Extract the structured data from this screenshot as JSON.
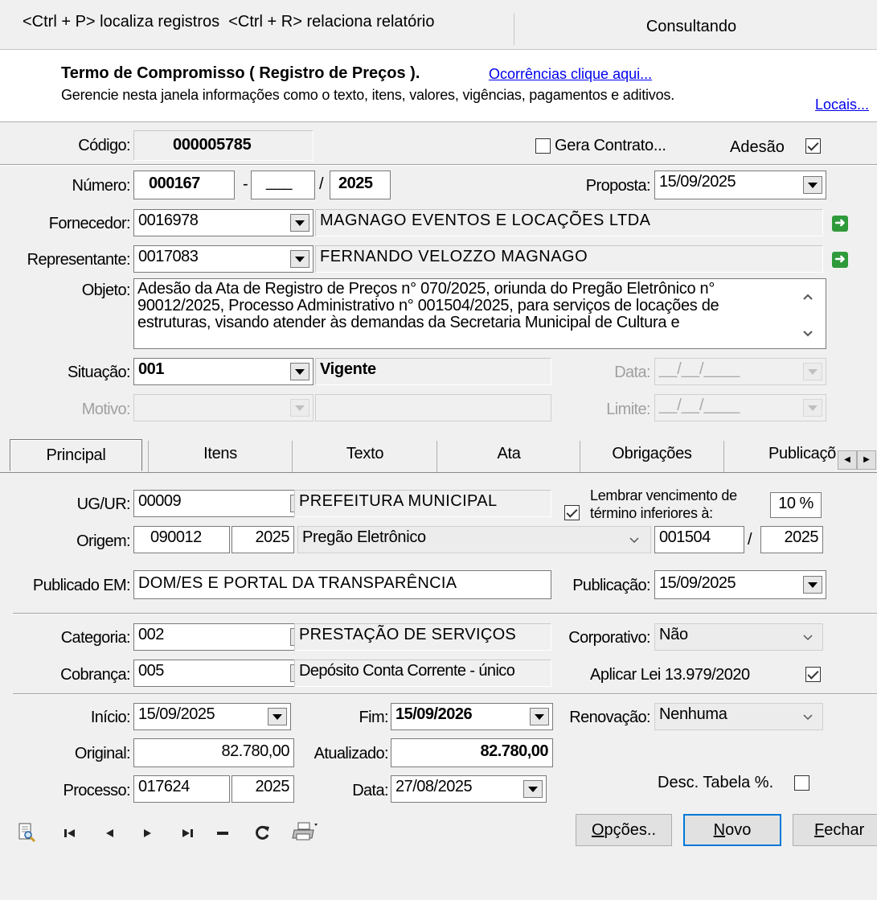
{
  "status_bar": {
    "shortcuts": "<Ctrl + P> localiza registros  <Ctrl + R> relaciona relatório",
    "mode": "Consultando"
  },
  "header": {
    "title": "Termo de Compromisso ( Registro de Preços ).",
    "occurrences_link": "Ocorrências clique aqui...",
    "description": "Gerencie nesta janela informações como o texto, itens, valores, vigências, pagamentos e aditivos.",
    "locais_link": "Locais..."
  },
  "form": {
    "codigo_label": "Código:",
    "codigo": "000005785",
    "gera_contrato_label": "Gera Contrato...",
    "gera_contrato": false,
    "adesao_label": "Adesão",
    "adesao": true,
    "numero_label": "Número:",
    "numero": "000167",
    "numero_sep": "-",
    "numero_suffix": "___",
    "numero_slash": "/",
    "numero_year": "2025",
    "proposta_label": "Proposta:",
    "proposta": "15/09/2025",
    "fornecedor_label": "Fornecedor:",
    "fornecedor_code": "0016978",
    "fornecedor_name": "MAGNAGO EVENTOS E LOCAÇÕES LTDA",
    "representante_label": "Representante:",
    "representante_code": "0017083",
    "representante_name": "FERNANDO VELOZZO MAGNAGO",
    "objeto_label": "Objeto:",
    "objeto_line1": "Adesão da Ata de Registro de Preços n° 070/2025, oriunda do Pregão Eletrônico n°",
    "objeto_line2": "90012/2025, Processo Administrativo n° 001504/2025, para serviços de locações de",
    "objeto_line3": "estruturas, visando atender às demandas da Secretaria Municipal de Cultura e",
    "situacao_label": "Situação:",
    "situacao_code": "001",
    "situacao_name": "Vigente",
    "data_label": "Data:",
    "data": "__/__/____",
    "motivo_label": "Motivo:",
    "motivo": "",
    "limite_label": "Limite:",
    "limite": "__/__/____"
  },
  "tabs": [
    "Principal",
    "Itens",
    "Texto",
    "Ata",
    "Obrigações",
    "Publicaçõ"
  ],
  "principal": {
    "ugur_label": "UG/UR:",
    "ugur_code": "00009",
    "ugur_name": "PREFEITURA MUNICIPAL",
    "lembrar_label_1": "Lembrar vencimento de",
    "lembrar_label_2": "término inferiores à:",
    "lembrar": true,
    "lembrar_pct": "10 %",
    "origem_label": "Origem:",
    "origem_num": "090012",
    "origem_year": "2025",
    "origem_modalidade": "Pregão Eletrônico",
    "origem_proc": "001504",
    "origem_slash": "/",
    "origem_proc_year": "2025",
    "publicado_label": "Publicado EM:",
    "publicado": "DOM/ES E PORTAL DA TRANSPARÊNCIA",
    "publicacao_label": "Publicação:",
    "publicacao": "15/09/2025",
    "categoria_label": "Categoria:",
    "categoria_code": "002",
    "categoria_name": "PRESTAÇÃO DE SERVIÇOS",
    "corporativo_label": "Corporativo:",
    "corporativo": "Não",
    "cobranca_label": "Cobrança:",
    "cobranca_code": "005",
    "cobranca_name": "Depósito Conta Corrente - único",
    "lei_label": "Aplicar Lei 13.979/2020",
    "lei": true,
    "inicio_label": "Início:",
    "inicio": "15/09/2025",
    "fim_label": "Fim:",
    "fim": "15/09/2026",
    "renovacao_label": "Renovação:",
    "renovacao": "Nenhuma",
    "original_label": "Original:",
    "original": "82.780,00",
    "atualizado_label": "Atualizado:",
    "atualizado": "82.780,00",
    "processo_label": "Processo:",
    "processo_num": "017624",
    "processo_year": "2025",
    "proc_data_label": "Data:",
    "proc_data": "27/08/2025",
    "desc_label": "Desc. Tabela %.",
    "desc": false
  },
  "buttons": {
    "opcoes_pre": "O",
    "opcoes_rest": "pções..",
    "novo_pre": "N",
    "novo_rest": "ovo",
    "fechar_pre": "F",
    "fechar_rest": "echar"
  },
  "icons": [
    "print-preview-icon",
    "first-record-icon",
    "previous-record-icon",
    "next-record-icon",
    "last-record-icon",
    "delete-record-icon",
    "refresh-icon",
    "printer-icon"
  ]
}
